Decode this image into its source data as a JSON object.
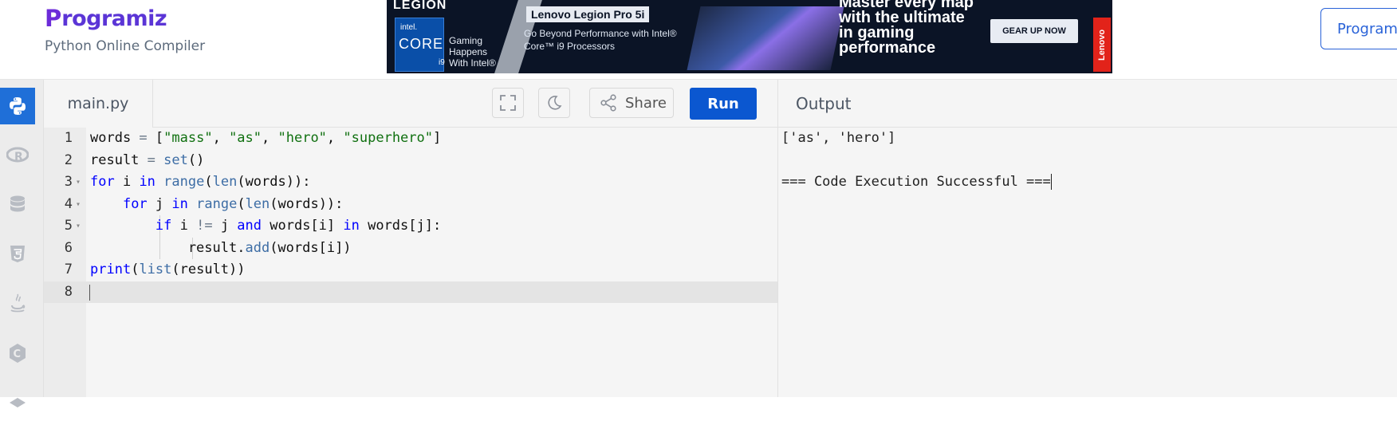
{
  "brand": {
    "logo_p": "P",
    "logo_rest": "rogramiz",
    "subtitle": "Python Online Compiler"
  },
  "ad": {
    "legion": "LEGION",
    "intel_brand": "intel.",
    "intel_core": "CORE",
    "intel_gen": "i9",
    "gaming": "Gaming Happens With Intel®",
    "model": "Lenovo Legion Pro 5i",
    "beyond": "Go Beyond Performance with Intel® Core™ i9 Processors",
    "headline": "Master every map with the ultimate in gaming performance",
    "cta": "GEAR UP NOW",
    "brand_tag": "Lenovo"
  },
  "top_right_button": "Programiz",
  "sidebar": {
    "items": [
      {
        "icon": "python-icon",
        "active": true
      },
      {
        "icon": "r-icon"
      },
      {
        "icon": "database-icon"
      },
      {
        "icon": "html5-icon"
      },
      {
        "icon": "java-icon"
      },
      {
        "icon": "c-icon"
      }
    ]
  },
  "editor": {
    "filename": "main.py",
    "share_label": "Share",
    "run_label": "Run",
    "line_numbers": [
      "1",
      "2",
      "3",
      "4",
      "5",
      "6",
      "7",
      "8"
    ],
    "current_line": "8"
  },
  "output": {
    "title": "Output",
    "lines": [
      "['as', 'hero']",
      "",
      "=== Code Execution Successful ==="
    ]
  },
  "colors": {
    "accent": "#0b57d0",
    "sidebar_active": "#1f6fd8",
    "logo": "#5b35d6"
  }
}
